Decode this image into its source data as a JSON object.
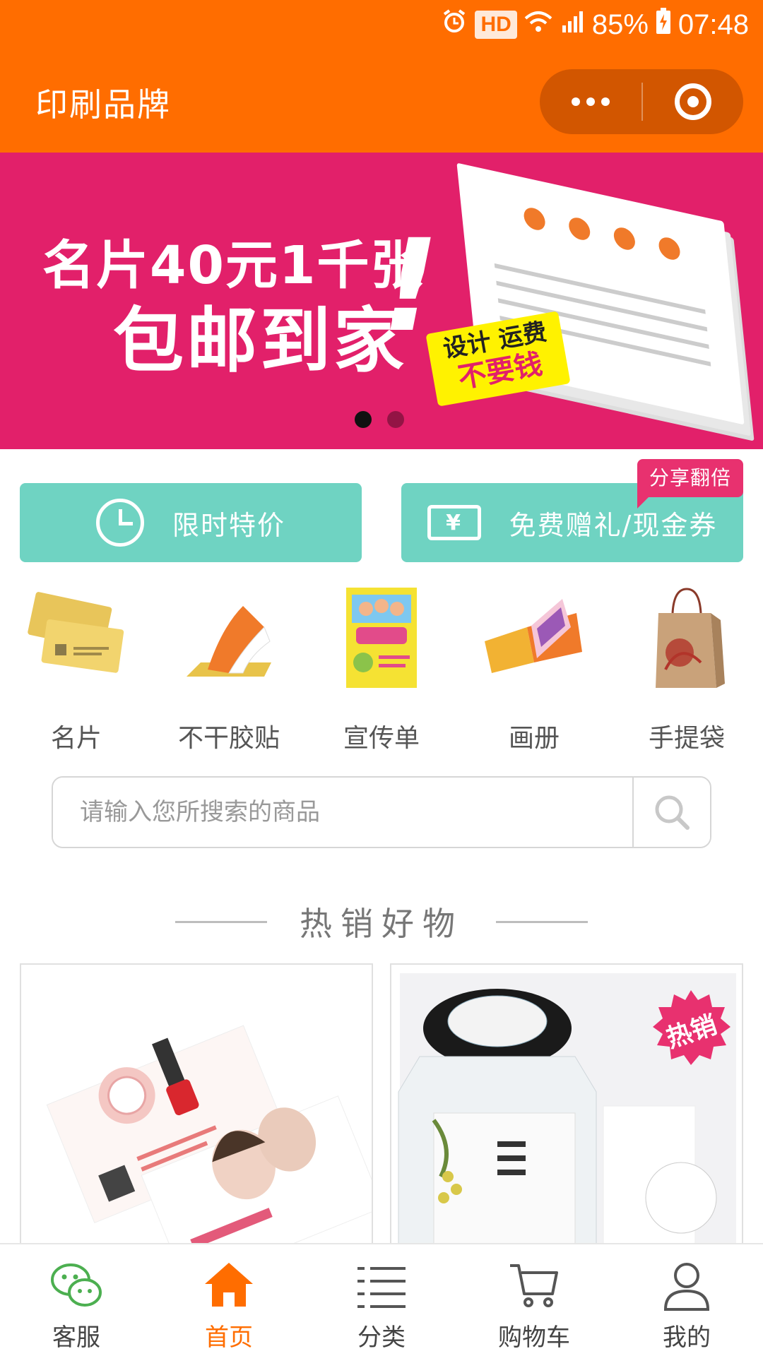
{
  "status_bar": {
    "hd_label": "HD",
    "network": "4G",
    "battery": "85%",
    "time": "07:48"
  },
  "header": {
    "title": "印刷品牌",
    "more_icon": "more-dots-icon",
    "close_icon": "target-circle-icon"
  },
  "banner": {
    "line1": "名片40元1千张",
    "line2": "包邮到家",
    "exclamation": "!",
    "tag_line1": "设计 运费",
    "tag_line2": "不要钱",
    "slide_count": 2,
    "active_slide": 1
  },
  "promos": {
    "left_label": "限时特价",
    "right_label": "免费赠礼/现金券",
    "right_badge": "分享翻倍",
    "ticket_symbol": "¥"
  },
  "categories": [
    {
      "label": "名片",
      "icon": "business-card-icon"
    },
    {
      "label": "不干胶贴",
      "icon": "sticker-icon"
    },
    {
      "label": "宣传单",
      "icon": "flyer-icon"
    },
    {
      "label": "画册",
      "icon": "brochure-icon"
    },
    {
      "label": "手提袋",
      "icon": "paper-bag-icon"
    }
  ],
  "search": {
    "placeholder": "请输入您所搜索的商品",
    "icon": "search-icon"
  },
  "hot_section": {
    "title": "热销好物"
  },
  "products": [
    {
      "badge": ""
    },
    {
      "badge": "热销"
    }
  ],
  "tabbar": {
    "items": [
      {
        "label": "客服",
        "icon": "wechat-chat-icon"
      },
      {
        "label": "首页",
        "icon": "home-icon"
      },
      {
        "label": "分类",
        "icon": "list-icon"
      },
      {
        "label": "购物车",
        "icon": "cart-icon"
      },
      {
        "label": "我的",
        "icon": "user-icon"
      }
    ],
    "active_index": 1
  },
  "colors": {
    "brand_orange": "#FF6D00",
    "banner_pink": "#E2206A",
    "promo_teal": "#6FD3C2",
    "badge_pink": "#E8316F"
  }
}
